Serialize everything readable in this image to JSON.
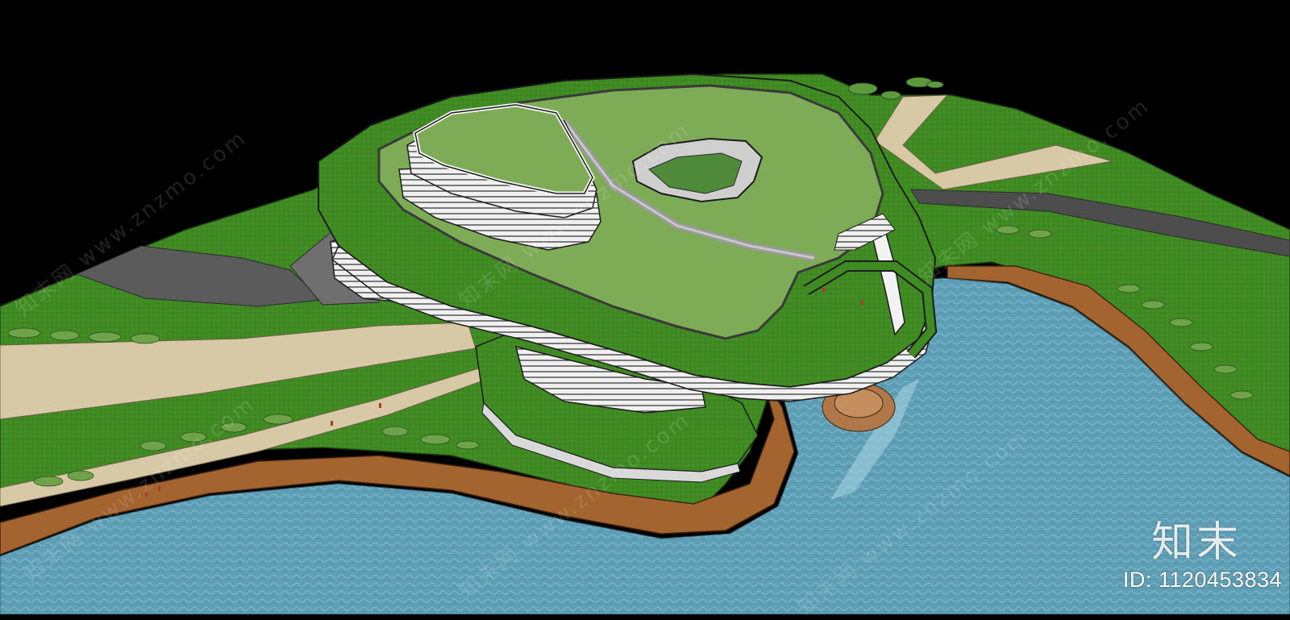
{
  "watermark": {
    "logo_text": "知末",
    "id_text": "ID: 1120453834",
    "diagonal_text": "知末网 www.znzmo.com"
  },
  "palette": {
    "sky": "#000000",
    "grass": "#3f8a22",
    "roof_green": "#7eab56",
    "water": "#5f9fb6",
    "shore": "#a4642f",
    "path_sand": "#d8c9a6",
    "road": "#5b5b5b",
    "building_white": "#f2f2f2"
  }
}
